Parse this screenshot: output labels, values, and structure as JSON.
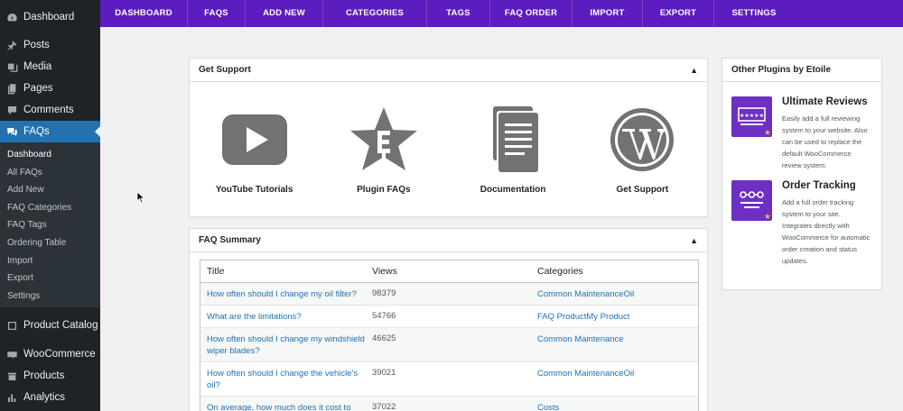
{
  "sidebar": {
    "top_items": [
      {
        "label": "Dashboard",
        "icon": "dashboard-icon"
      },
      {
        "label": "Posts",
        "icon": "pin-icon"
      },
      {
        "label": "Media",
        "icon": "media-icon"
      },
      {
        "label": "Pages",
        "icon": "pages-icon"
      },
      {
        "label": "Comments",
        "icon": "comments-icon"
      },
      {
        "label": "FAQs",
        "icon": "faq-icon"
      }
    ],
    "submenu": [
      "Dashboard",
      "All FAQs",
      "Add New",
      "FAQ Categories",
      "FAQ Tags",
      "Ordering Table",
      "Import",
      "Export",
      "Settings"
    ],
    "bottom_items": [
      {
        "label": "Product Catalog",
        "icon": "catalog-icon"
      },
      {
        "label": "WooCommerce",
        "icon": "woocommerce-icon"
      },
      {
        "label": "Products",
        "icon": "products-icon"
      },
      {
        "label": "Analytics",
        "icon": "analytics-icon"
      }
    ],
    "accent_color": "#2271b1"
  },
  "topnav": {
    "items": [
      "DASHBOARD",
      "FAQS",
      "ADD NEW",
      "CATEGORIES",
      "TAGS",
      "FAQ ORDER",
      "IMPORT",
      "EXPORT",
      "SETTINGS"
    ],
    "bg_color": "#5b1dbf"
  },
  "support": {
    "title": "Get Support",
    "toggle": "▲",
    "items": [
      {
        "label": "YouTube Tutorials",
        "icon": "youtube-icon"
      },
      {
        "label": "Plugin FAQs",
        "icon": "star-faq-icon"
      },
      {
        "label": "Documentation",
        "icon": "documents-icon"
      },
      {
        "label": "Get Support",
        "icon": "wordpress-icon"
      }
    ]
  },
  "summary": {
    "title": "FAQ Summary",
    "toggle": "▲",
    "columns": [
      "Title",
      "Views",
      "Categories"
    ],
    "rows": [
      {
        "title": "How often should I change my oil filter?",
        "views": "98379",
        "categories": "Common MaintenanceOil"
      },
      {
        "title": "What are the limitations?",
        "views": "54766",
        "categories": "FAQ ProductMy Product"
      },
      {
        "title": "How often should I change my windshield wiper blades?",
        "views": "46625",
        "categories": "Common Maintenance"
      },
      {
        "title": "How often should I change the vehicle's oil?",
        "views": "39021",
        "categories": "Common MaintenanceOil"
      },
      {
        "title": "On average, how much does it cost to",
        "views": "37022",
        "categories": "Costs"
      }
    ]
  },
  "plugins": {
    "title": "Other Plugins by Etoile",
    "items": [
      {
        "name": "Ultimate Reviews",
        "icon": "reviews-icon",
        "description": "Easily add a full reviewing system to your website. Also can be used to replace the default WooCommerce review system."
      },
      {
        "name": "Order Tracking",
        "icon": "order-tracking-icon",
        "description": "Add a full order tracking system to your site. Integrates directly with WooCommerce for automatic order creation and status updates."
      }
    ],
    "icon_color": "#6d2fc4"
  }
}
